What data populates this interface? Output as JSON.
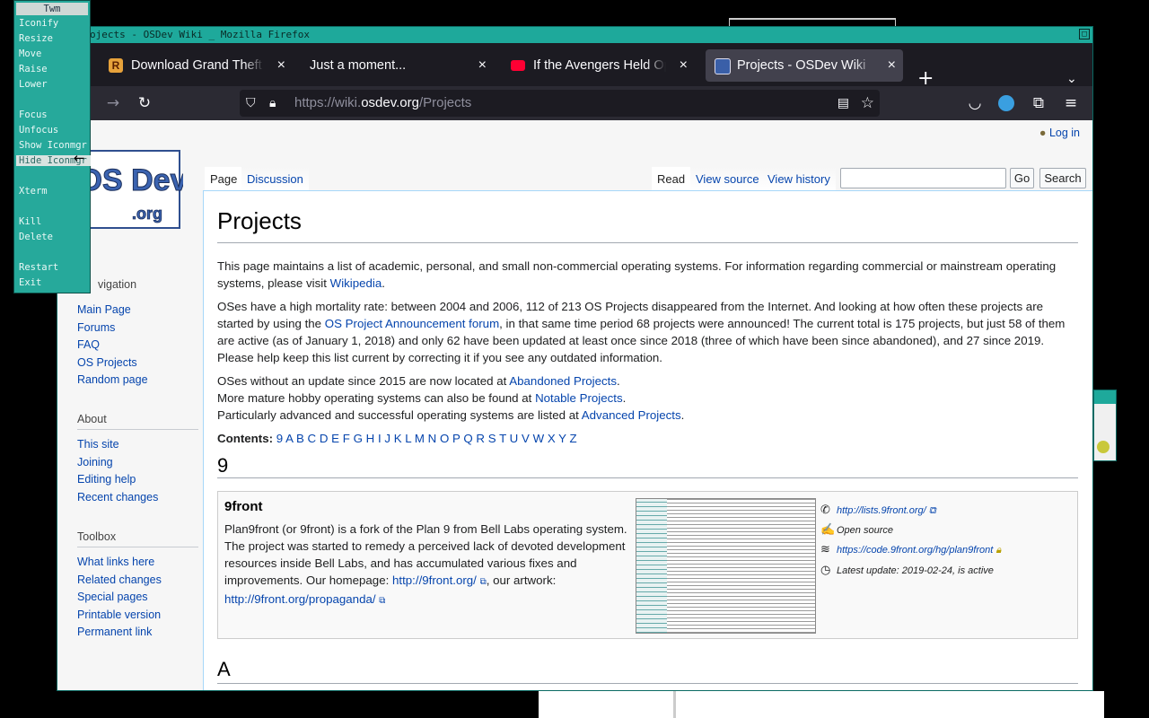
{
  "wm_menu": {
    "title": "Twm",
    "items": [
      {
        "label": "Iconify"
      },
      {
        "label": "Resize"
      },
      {
        "label": "Move"
      },
      {
        "label": "Raise"
      },
      {
        "label": "Lower"
      },
      {
        "label": "Focus"
      },
      {
        "label": "Unfocus"
      },
      {
        "label": "Show Iconmgr"
      },
      {
        "label": "Hide Iconmgr"
      },
      {
        "label": "Xterm"
      },
      {
        "label": "Kill"
      },
      {
        "label": "Delete"
      },
      {
        "label": "Restart"
      },
      {
        "label": "Exit"
      }
    ],
    "highlighted": "Hide Iconmgr"
  },
  "window": {
    "title": "ojects - OSDev Wiki _ Mozilla Firefox"
  },
  "tabs": [
    {
      "label": "Download Grand Theft Auto",
      "favicon": "rockstar-icon",
      "close": "×"
    },
    {
      "label": "Just a moment...",
      "favicon": "none",
      "close": "×"
    },
    {
      "label": "If the Avengers Held Open",
      "favicon": "youtube-icon",
      "close": "×"
    },
    {
      "label": "Projects - OSDev Wiki",
      "favicon": "osdev-icon",
      "close": "×",
      "active": true
    }
  ],
  "navbar": {
    "url_scheme": "https://wiki.",
    "url_domain": "osdev.org",
    "url_path": "/Projects"
  },
  "wiki": {
    "login": "Log in",
    "logo_text_1": "OS Dev",
    "logo_text_2": ".org",
    "page_tabs": {
      "page": "Page",
      "discussion": "Discussion",
      "read": "Read",
      "view_source": "View source",
      "view_history": "View history"
    },
    "search": {
      "go": "Go",
      "search": "Search"
    },
    "navigation_heading": "vigation",
    "navigation": [
      "Main Page",
      "Forums",
      "FAQ",
      "OS Projects",
      "Random page"
    ],
    "about_heading": "About",
    "about": [
      "This site",
      "Joining",
      "Editing help",
      "Recent changes"
    ],
    "toolbox_heading": "Toolbox",
    "toolbox": [
      "What links here",
      "Related changes",
      "Special pages",
      "Printable version",
      "Permanent link"
    ],
    "title": "Projects",
    "p1": "This page maintains a list of academic, personal, and small non-commercial operating systems. For information regarding commercial or mainstream operating systems, please visit",
    "p1_link": "Wikipedia",
    "p2_a": "OSes have a high mortality rate: between 2004 and 2006, 112 of 213 OS Projects disappeared from the Internet. And looking at how often these projects are started by using the",
    "p2_link": "OS Project Announcement forum",
    "p2_b": ", in that same time period 68 projects were announced! The current total is 175 projects, but just 58 of them are active (as of January 1, 2018) and only 62 have been updated at least once since 2018 (three of which have been since abandoned), and 27 since 2019. Please help keep this list current by correcting it if you see any outdated information.",
    "p3_a": "OSes without an update since 2015 are now located at",
    "p3_link": "Abandoned Projects",
    "p4_a": "More mature hobby operating systems can also be found at",
    "p4_link": "Notable Projects",
    "p5_a": "Particularly advanced and successful operating systems are listed at",
    "p5_link": "Advanced Projects",
    "contents_label": "Contents:",
    "contents": [
      "9",
      "A",
      "B",
      "C",
      "D",
      "E",
      "F",
      "G",
      "H",
      "I",
      "J",
      "K",
      "L",
      "M",
      "N",
      "O",
      "P",
      "Q",
      "R",
      "S",
      "T",
      "U",
      "V",
      "W",
      "X",
      "Y",
      "Z"
    ],
    "section_9": "9",
    "section_a": "A",
    "os": {
      "name": "9front",
      "desc": "Plan9front (or 9front) is a fork of the Plan 9 from Bell Labs operating system. The project was started to remedy a perceived lack of devoted development resources inside Bell Labs, and has accumulated various fixes and improvements. Our homepage:",
      "homepage": "http://9front.org/",
      "artwork_label": ", our artwork:",
      "artwork": "http://9front.org/propaganda/",
      "mailing": "http://lists.9front.org/",
      "license": "Open source",
      "repo": "https://code.9front.org/hg/plan9front",
      "update": "Latest update: 2019-02-24, is active"
    }
  }
}
